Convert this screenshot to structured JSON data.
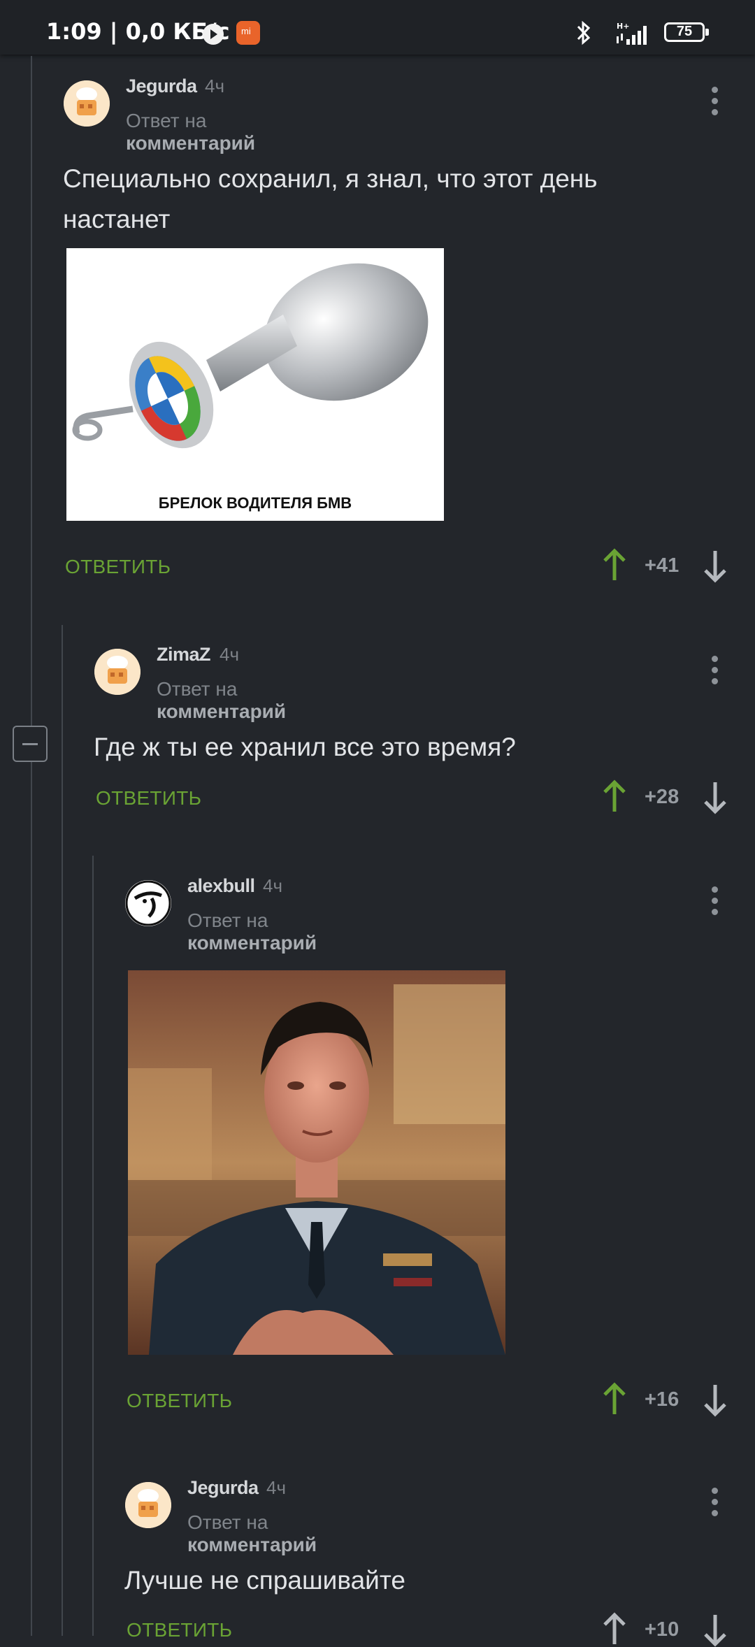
{
  "status_bar": {
    "time_speed": "1:09 | 0,0 КБ/с",
    "battery": "75"
  },
  "comments": [
    {
      "username": "Jegurda",
      "time": "4ч",
      "reply_prefix": "Ответ на",
      "reply_target": "комментарий",
      "text": "Специально сохранил, я знал, что этот день настанет",
      "image_caption": "БРЕЛОК ВОДИТЕЛЯ БМВ",
      "reply_label": "ОТВЕТИТЬ",
      "score": "+41"
    },
    {
      "username": "ZimaZ",
      "time": "4ч",
      "reply_prefix": "Ответ на",
      "reply_target": "комментарий",
      "text": "Где ж ты ее хранил все это время?",
      "reply_label": "ОТВЕТИТЬ",
      "score": "+28"
    },
    {
      "username": "alexbull",
      "time": "4ч",
      "reply_prefix": "Ответ на",
      "reply_target": "комментарий",
      "reply_label": "ОТВЕТИТЬ",
      "score": "+16"
    },
    {
      "username": "Jegurda",
      "time": "4ч",
      "reply_prefix": "Ответ на",
      "reply_target": "комментарий",
      "text": "Лучше не спрашивайте",
      "reply_label": "ОТВЕТИТЬ",
      "score": "+10"
    }
  ],
  "colors": {
    "background": "#23262b",
    "accent_green": "#6aa334",
    "thread_line": "#41464d"
  },
  "icons": [
    "bluetooth-icon",
    "signal-icon",
    "battery-icon",
    "arrow-up-icon",
    "arrow-down-icon",
    "more-vert-icon",
    "collapse-icon"
  ]
}
